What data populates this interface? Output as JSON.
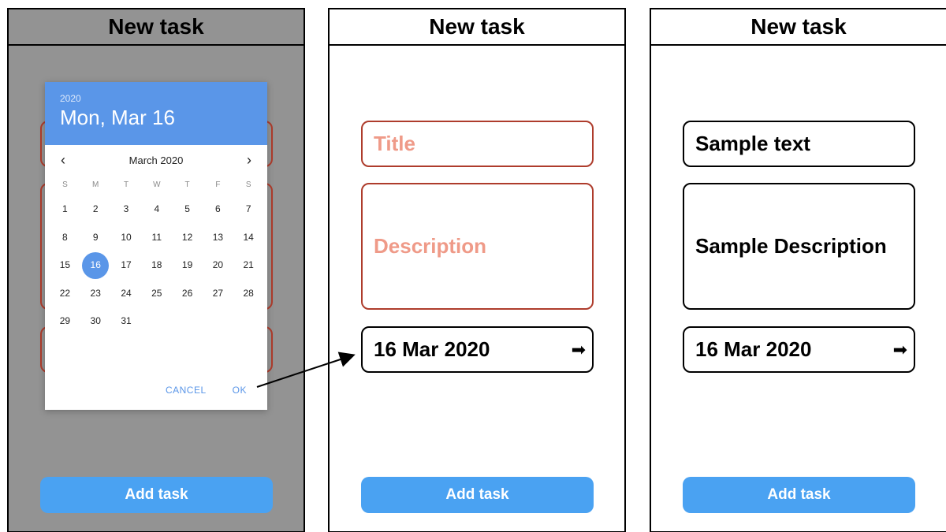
{
  "screens": [
    {
      "header": "New task",
      "date_picker": {
        "year": "2020",
        "selected_long": "Mon, Mar 16",
        "month_label": "March 2020",
        "prev_icon": "‹",
        "next_icon": "›",
        "weekdays": [
          "S",
          "M",
          "T",
          "W",
          "T",
          "F",
          "S"
        ],
        "weeks": [
          [
            "1",
            "2",
            "3",
            "4",
            "5",
            "6",
            "7"
          ],
          [
            "8",
            "9",
            "10",
            "11",
            "12",
            "13",
            "14"
          ],
          [
            "15",
            "16",
            "17",
            "18",
            "19",
            "20",
            "21"
          ],
          [
            "22",
            "23",
            "24",
            "25",
            "26",
            "27",
            "28"
          ],
          [
            "29",
            "30",
            "31",
            "",
            "",
            "",
            ""
          ]
        ],
        "selected_day": "16",
        "cancel_label": "CANCEL",
        "ok_label": "OK"
      },
      "add_button": "Add task"
    },
    {
      "header": "New task",
      "title_placeholder": "Title",
      "description_placeholder": "Description",
      "date_value": "16 Mar 2020",
      "add_button": "Add task"
    },
    {
      "header": "New task",
      "title_value": "Sample text",
      "description_value": "Sample Description",
      "date_value": "16 Mar 2020",
      "add_button": "Add task"
    }
  ],
  "icons": {
    "date_arrow": "arrow-right-icon",
    "annotation": "connector-arrow"
  },
  "colors": {
    "accent": "#4aa2f2",
    "picker_blue": "#5a96e8",
    "error_border": "#ae3c2c",
    "placeholder": "#ef9a88",
    "dim_overlay": "#939393"
  }
}
